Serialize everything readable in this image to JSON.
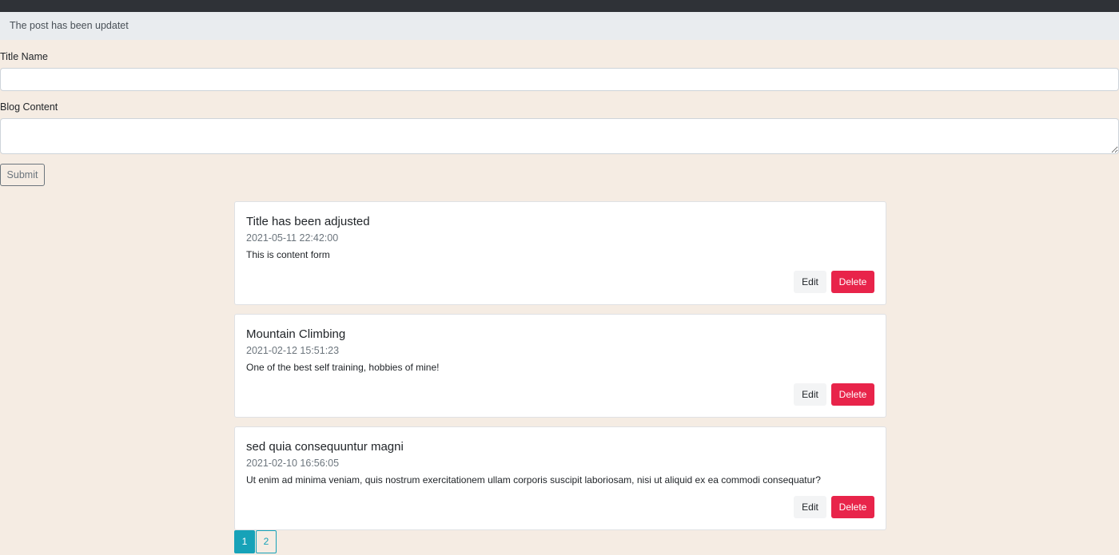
{
  "alert": {
    "message": "The post has been updatet"
  },
  "form": {
    "title_label": "Title Name",
    "title_value": "",
    "content_label": "Blog Content",
    "content_value": "",
    "submit_label": "Submit"
  },
  "posts": [
    {
      "title": "Title has been adjusted",
      "date": "2021-05-11 22:42:00",
      "content": "This is content form",
      "edit_label": "Edit",
      "delete_label": "Delete"
    },
    {
      "title": "Mountain Climbing",
      "date": "2021-02-12 15:51:23",
      "content": "One of the best self training, hobbies of mine!",
      "edit_label": "Edit",
      "delete_label": "Delete"
    },
    {
      "title": "sed quia consequuntur magni",
      "date": "2021-02-10 16:56:05",
      "content": "Ut enim ad minima veniam, quis nostrum exercitationem ullam corporis suscipit laboriosam, nisi ut aliquid ex ea commodi consequatur?",
      "edit_label": "Edit",
      "delete_label": "Delete"
    }
  ],
  "pagination": {
    "pages": [
      "1",
      "2"
    ],
    "active": "1"
  },
  "colors": {
    "accent": "#17a2b8",
    "danger": "#e8244a",
    "background": "#f5ece3",
    "topbar": "#2f3237"
  }
}
